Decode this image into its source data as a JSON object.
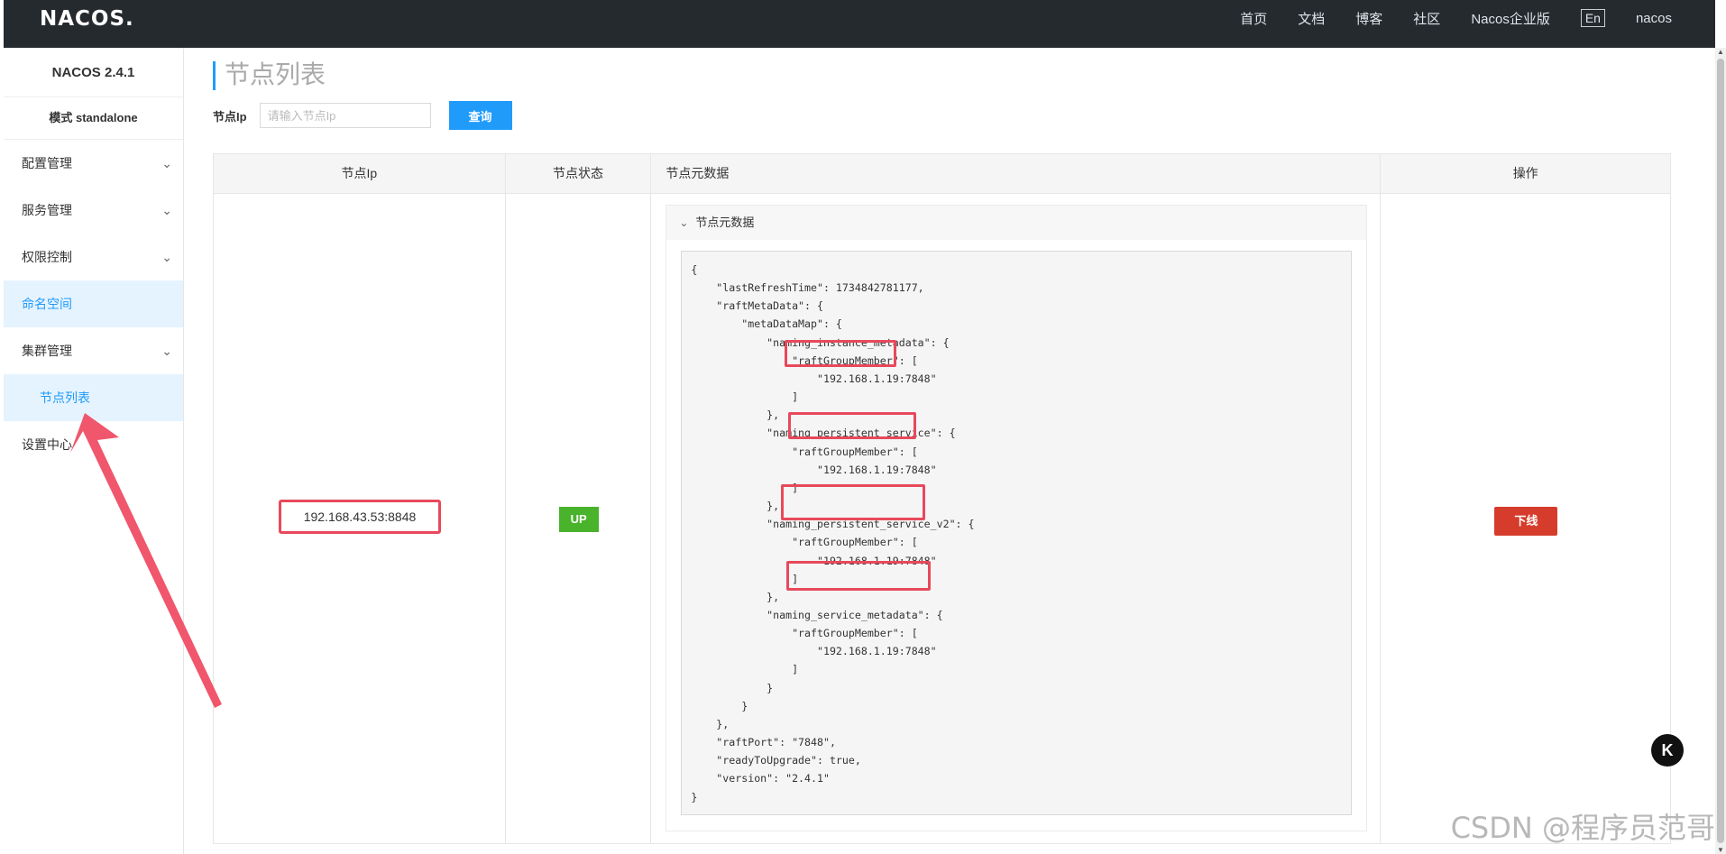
{
  "header": {
    "logo": "NACOS.",
    "nav": [
      "首页",
      "文档",
      "博客",
      "社区",
      "Nacos企业版"
    ],
    "lang": "En",
    "user": "nacos"
  },
  "sidebar": {
    "version": "NACOS 2.4.1",
    "mode": "模式 standalone",
    "items": [
      {
        "label": "配置管理",
        "has_children": true
      },
      {
        "label": "服务管理",
        "has_children": true
      },
      {
        "label": "权限控制",
        "has_children": true
      },
      {
        "label": "命名空间",
        "has_children": false,
        "active": true
      },
      {
        "label": "集群管理",
        "has_children": true
      },
      {
        "label": "节点列表",
        "sub": true,
        "active": true
      },
      {
        "label": "设置中心",
        "has_children": false
      }
    ]
  },
  "page": {
    "title": "节点列表",
    "filter_label": "节点Ip",
    "filter_placeholder": "请输入节点Ip",
    "query_button": "查询"
  },
  "table": {
    "columns": [
      "节点Ip",
      "节点状态",
      "节点元数据",
      "操作"
    ],
    "rows": [
      {
        "ip": "192.168.43.53:8848",
        "status": "UP",
        "metadata_title": "节点元数据",
        "action": "下线",
        "metadata_json": "{\n    \"lastRefreshTime\": 1734842781177,\n    \"raftMetaData\": {\n        \"metaDataMap\": {\n            \"naming_instance_metadata\": {\n                \"raftGroupMember\": [\n                    \"192.168.1.19:7848\"\n                ]\n            },\n            \"naming_persistent_service\": {\n                \"raftGroupMember\": [\n                    \"192.168.1.19:7848\"\n                ]\n            },\n            \"naming_persistent_service_v2\": {\n                \"raftGroupMember\": [\n                    \"192.168.1.19:7848\"\n                ]\n            },\n            \"naming_service_metadata\": {\n                \"raftGroupMember\": [\n                    \"192.168.1.19:7848\"\n                ]\n            }\n        }\n    },\n    \"raftPort\": \"7848\",\n    \"readyToUpgrade\": true,\n    \"version\": \"2.4.1\"\n}"
      }
    ]
  },
  "floating_button": "K",
  "watermark": "CSDN @程序员范哥",
  "colors": {
    "topbar": "#252a2f",
    "accent": "#209bfa",
    "up": "#49b32b",
    "danger": "#d63c2b",
    "annotation": "#e8495b"
  }
}
